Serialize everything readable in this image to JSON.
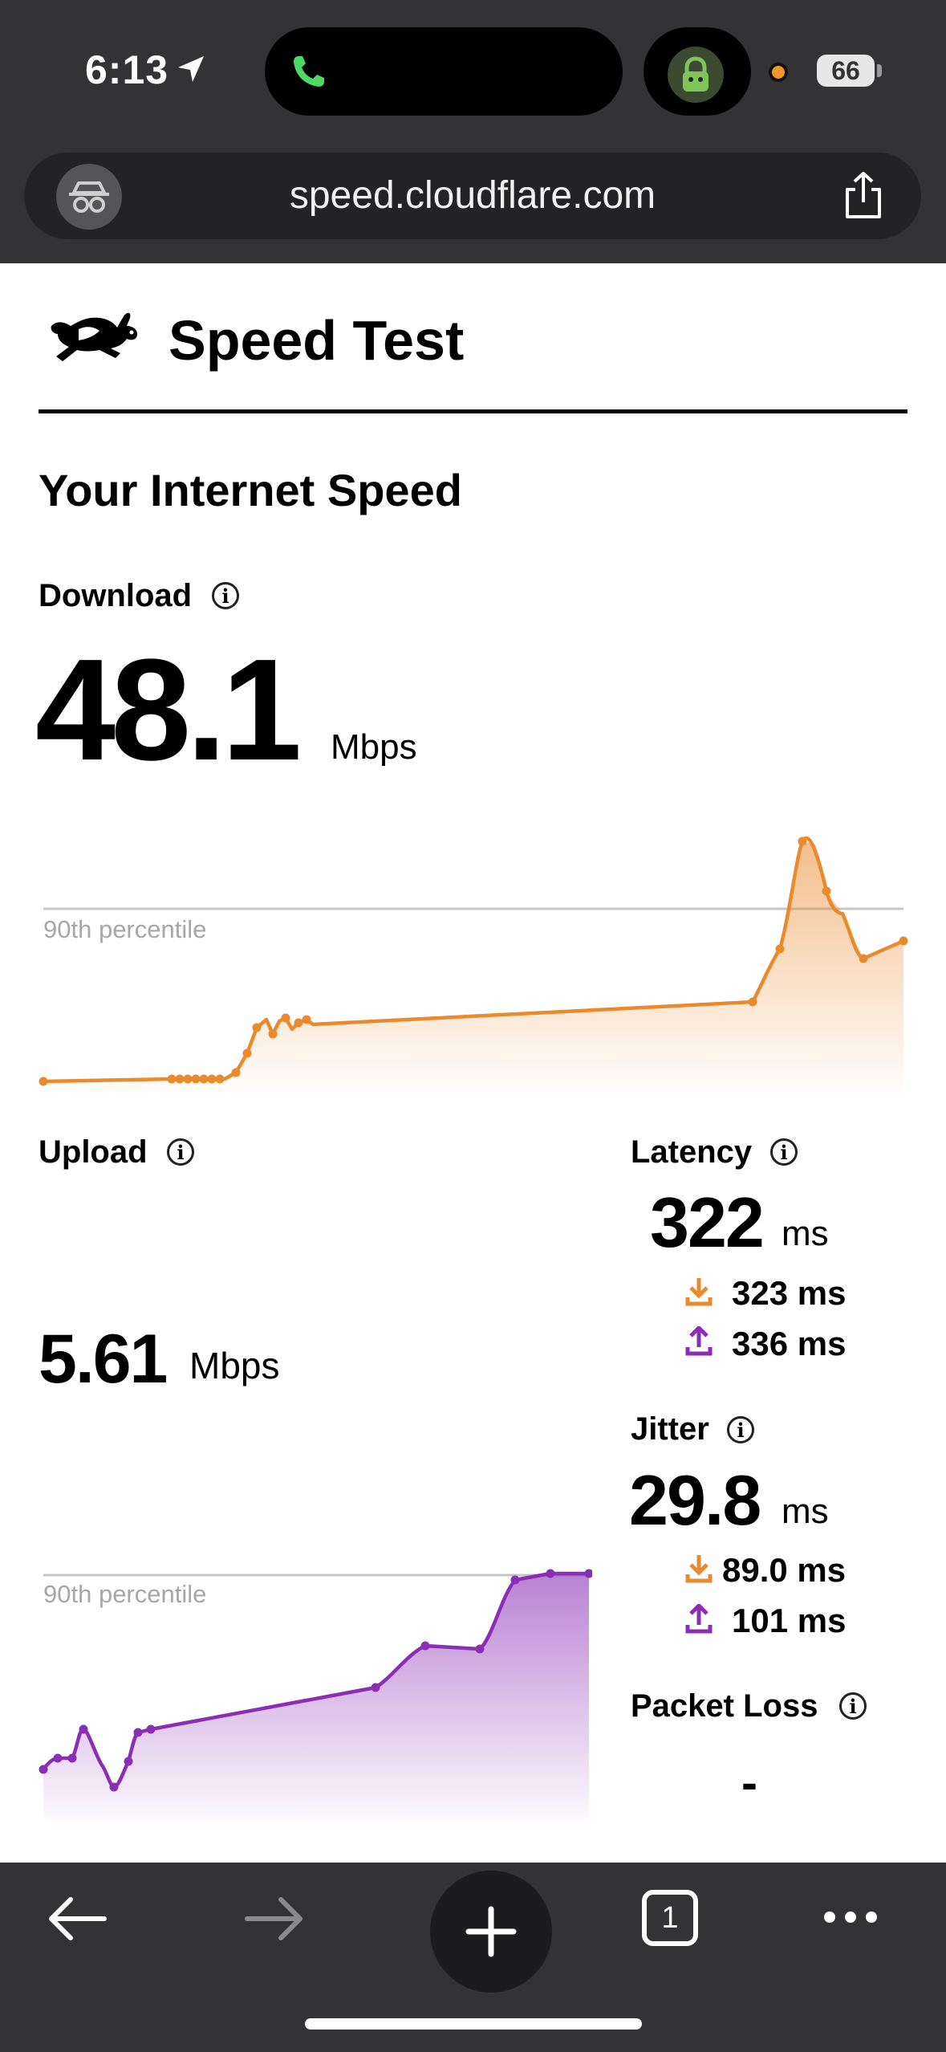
{
  "status_bar": {
    "time": "6:13",
    "battery": "66"
  },
  "browser": {
    "url": "speed.cloudflare.com",
    "tab_count": "1"
  },
  "page": {
    "title": "Speed Test",
    "heading": "Your Internet Speed",
    "download": {
      "label": "Download",
      "value": "48.1",
      "unit": "Mbps"
    },
    "upload": {
      "label": "Upload",
      "value": "5.61",
      "unit": "Mbps"
    },
    "percentile_label": "90th percentile",
    "latency": {
      "label": "Latency",
      "value": "322",
      "unit": "ms",
      "down": "323 ms",
      "up": "336 ms"
    },
    "jitter": {
      "label": "Jitter",
      "value": "29.8",
      "unit": "ms",
      "down": "89.0 ms",
      "up": "101 ms"
    },
    "packet_loss": {
      "label": "Packet Loss",
      "value": "-"
    },
    "info_glyph": "i"
  },
  "colors": {
    "download": "#e98a2d",
    "upload": "#8a2eb5",
    "topbar": "#333335"
  },
  "icons": [
    "location-arrow-icon",
    "phone-icon",
    "vpn-lock-icon",
    "incognito-icon",
    "share-icon",
    "rabbit-logo-icon",
    "info-icon",
    "download-arrow-icon",
    "upload-arrow-icon",
    "back-arrow-icon",
    "forward-arrow-icon",
    "plus-icon",
    "tabs-icon",
    "more-icon"
  ]
}
